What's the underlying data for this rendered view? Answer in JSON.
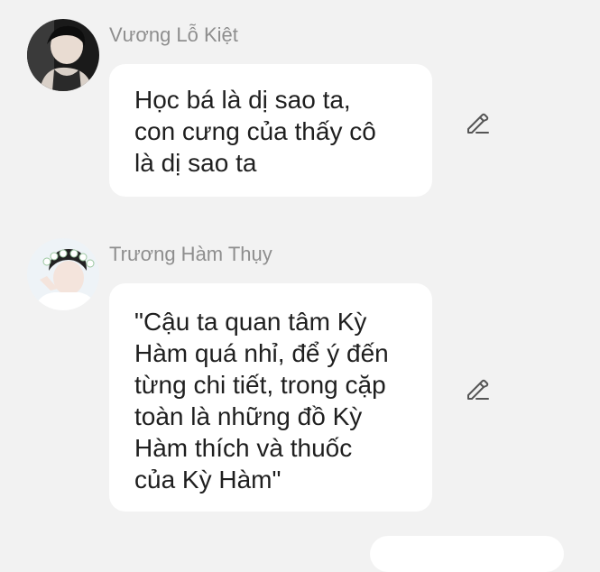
{
  "messages": [
    {
      "sender": "Vương Lỗ Kiệt",
      "text": "Học bá là dị sao ta,\ncon cưng của thấy cô\nlà dị sao ta",
      "avatar_icon": "user-avatar-photo",
      "action_icon": "pencil-icon"
    },
    {
      "sender": "Trương Hàm Thụy",
      "text": "\"Cậu ta quan tâm Kỳ\nHàm quá nhỉ, để ý đến\ntừng chi tiết, trong cặp\ntoàn là những đồ Kỳ\nHàm thích và thuốc\ncủa Kỳ Hàm\"",
      "avatar_icon": "user-avatar-photo",
      "action_icon": "pencil-icon"
    }
  ],
  "colors": {
    "background": "#f2f2f2",
    "bubble": "#ffffff",
    "sender_name": "#8e8e8e",
    "message_text": "#1f1f1f",
    "icon": "#555555"
  }
}
